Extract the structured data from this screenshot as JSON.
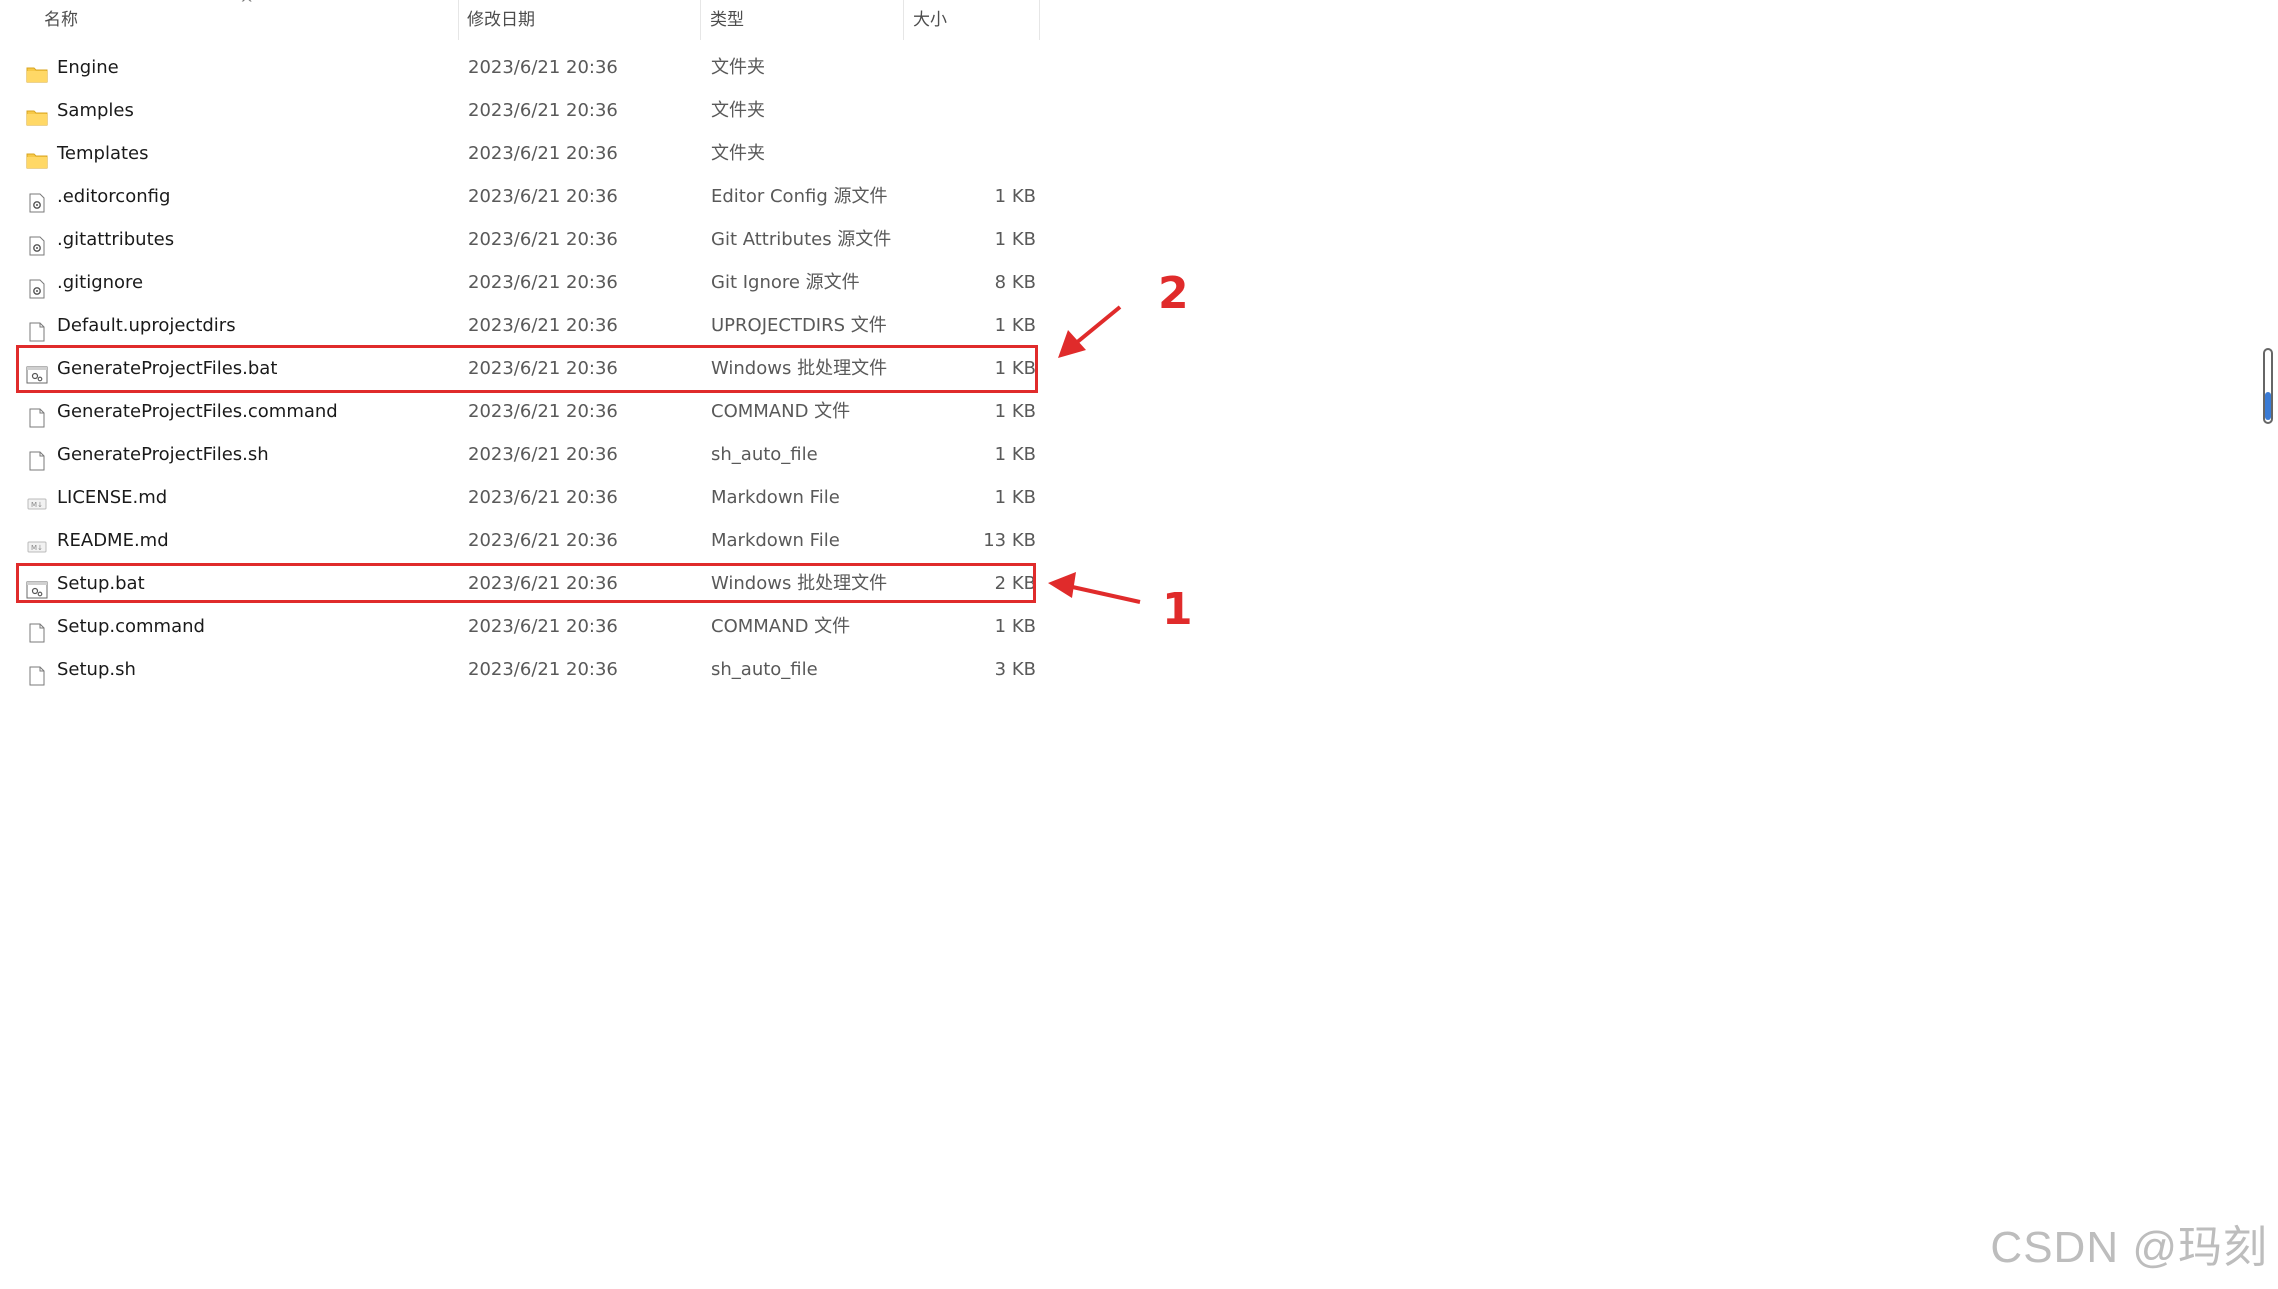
{
  "columns": {
    "name": "名称",
    "date": "修改日期",
    "type": "类型",
    "size": "大小"
  },
  "rows": [
    {
      "name": "Engine",
      "date": "2023/6/21 20:36",
      "type": "文件夹",
      "size": "",
      "icon": "folder-icon"
    },
    {
      "name": "Samples",
      "date": "2023/6/21 20:36",
      "type": "文件夹",
      "size": "",
      "icon": "folder-icon"
    },
    {
      "name": "Templates",
      "date": "2023/6/21 20:36",
      "type": "文件夹",
      "size": "",
      "icon": "folder-icon"
    },
    {
      "name": ".editorconfig",
      "date": "2023/6/21 20:36",
      "type": "Editor Config 源文件",
      "size": "1 KB",
      "icon": "config-file-icon"
    },
    {
      "name": ".gitattributes",
      "date": "2023/6/21 20:36",
      "type": "Git Attributes 源文件",
      "size": "1 KB",
      "icon": "config-file-icon"
    },
    {
      "name": ".gitignore",
      "date": "2023/6/21 20:36",
      "type": "Git Ignore 源文件",
      "size": "8 KB",
      "icon": "config-file-icon"
    },
    {
      "name": "Default.uprojectdirs",
      "date": "2023/6/21 20:36",
      "type": "UPROJECTDIRS 文件",
      "size": "1 KB",
      "icon": "blank-file-icon"
    },
    {
      "name": "GenerateProjectFiles.bat",
      "date": "2023/6/21 20:36",
      "type": "Windows 批处理文件",
      "size": "1 KB",
      "icon": "batch-file-icon"
    },
    {
      "name": "GenerateProjectFiles.command",
      "date": "2023/6/21 20:36",
      "type": "COMMAND 文件",
      "size": "1 KB",
      "icon": "blank-file-icon"
    },
    {
      "name": "GenerateProjectFiles.sh",
      "date": "2023/6/21 20:36",
      "type": "sh_auto_file",
      "size": "1 KB",
      "icon": "blank-file-icon"
    },
    {
      "name": "LICENSE.md",
      "date": "2023/6/21 20:36",
      "type": "Markdown File",
      "size": "1 KB",
      "icon": "markdown-file-icon"
    },
    {
      "name": "README.md",
      "date": "2023/6/21 20:36",
      "type": "Markdown File",
      "size": "13 KB",
      "icon": "markdown-file-icon"
    },
    {
      "name": "Setup.bat",
      "date": "2023/6/21 20:36",
      "type": "Windows 批处理文件",
      "size": "2 KB",
      "icon": "batch-file-icon"
    },
    {
      "name": "Setup.command",
      "date": "2023/6/21 20:36",
      "type": "COMMAND 文件",
      "size": "1 KB",
      "icon": "blank-file-icon"
    },
    {
      "name": "Setup.sh",
      "date": "2023/6/21 20:36",
      "type": "sh_auto_file",
      "size": "3 KB",
      "icon": "blank-file-icon"
    }
  ],
  "annotations": {
    "label_1": "1",
    "label_2": "2",
    "color": "#e02b2b"
  },
  "watermark": "CSDN @玛刻"
}
